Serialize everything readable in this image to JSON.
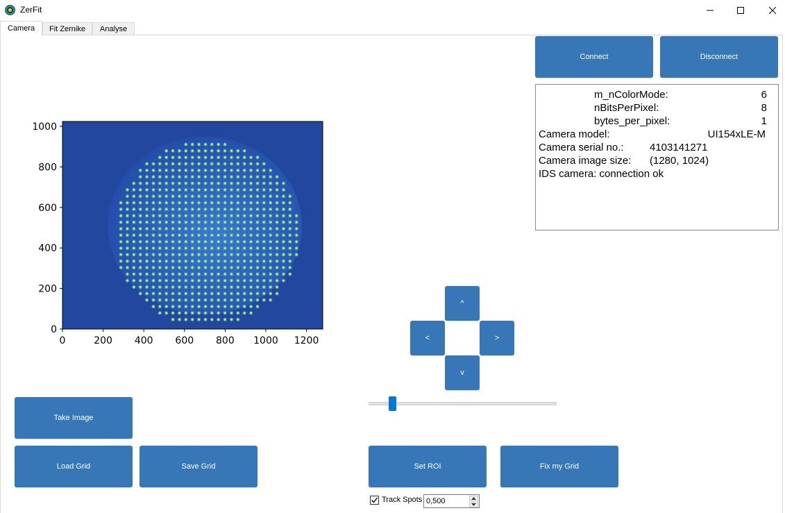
{
  "window": {
    "title": "ZerFit",
    "icon": "zerfit-app-icon"
  },
  "tabs": [
    {
      "label": "Camera",
      "active": true
    },
    {
      "label": "Fit Zernike",
      "active": false
    },
    {
      "label": "Analyse",
      "active": false
    }
  ],
  "camera": {
    "connect_label": "Connect",
    "disconnect_label": "Disconnect",
    "info": {
      "color_mode_key": "m_nColorMode:",
      "color_mode_val": "6",
      "bits_key": "nBitsPerPixel:",
      "bits_val": "8",
      "bytes_key": "bytes_per_pixel:",
      "bytes_val": "1",
      "model_key": "Camera model:",
      "model_val": "UI154xLE-M",
      "serial_key": "Camera serial no.:",
      "serial_val": "4103141271",
      "size_key": "Camera image size:",
      "size_val": "(1280, 1024)",
      "status": "IDS camera: connection ok"
    },
    "nav": {
      "up": "^",
      "left": "<",
      "right": ">",
      "down": "v"
    },
    "slider_value_fraction": 0.11,
    "buttons": {
      "take_image": "Take Image",
      "load_grid": "Load Grid",
      "save_grid": "Save Grid",
      "set_roi": "Set ROI",
      "fix_grid": "Fix my Grid"
    },
    "track_spots": {
      "label": "Track Spots",
      "checked": true,
      "value": "0,500"
    }
  },
  "image_plot": {
    "x_ticks": [
      "0",
      "200",
      "400",
      "600",
      "800",
      "1000",
      "1200"
    ],
    "y_ticks": [
      "0",
      "200",
      "400",
      "600",
      "800",
      "1000"
    ],
    "x_range": [
      0,
      1280
    ],
    "y_range": [
      0,
      1024
    ],
    "colors": {
      "background": "#21479f",
      "spot": "#b6f56a",
      "glow": "#3f86d0"
    }
  },
  "colors": {
    "accent": "#3877b7",
    "slider": "#0078d7"
  }
}
